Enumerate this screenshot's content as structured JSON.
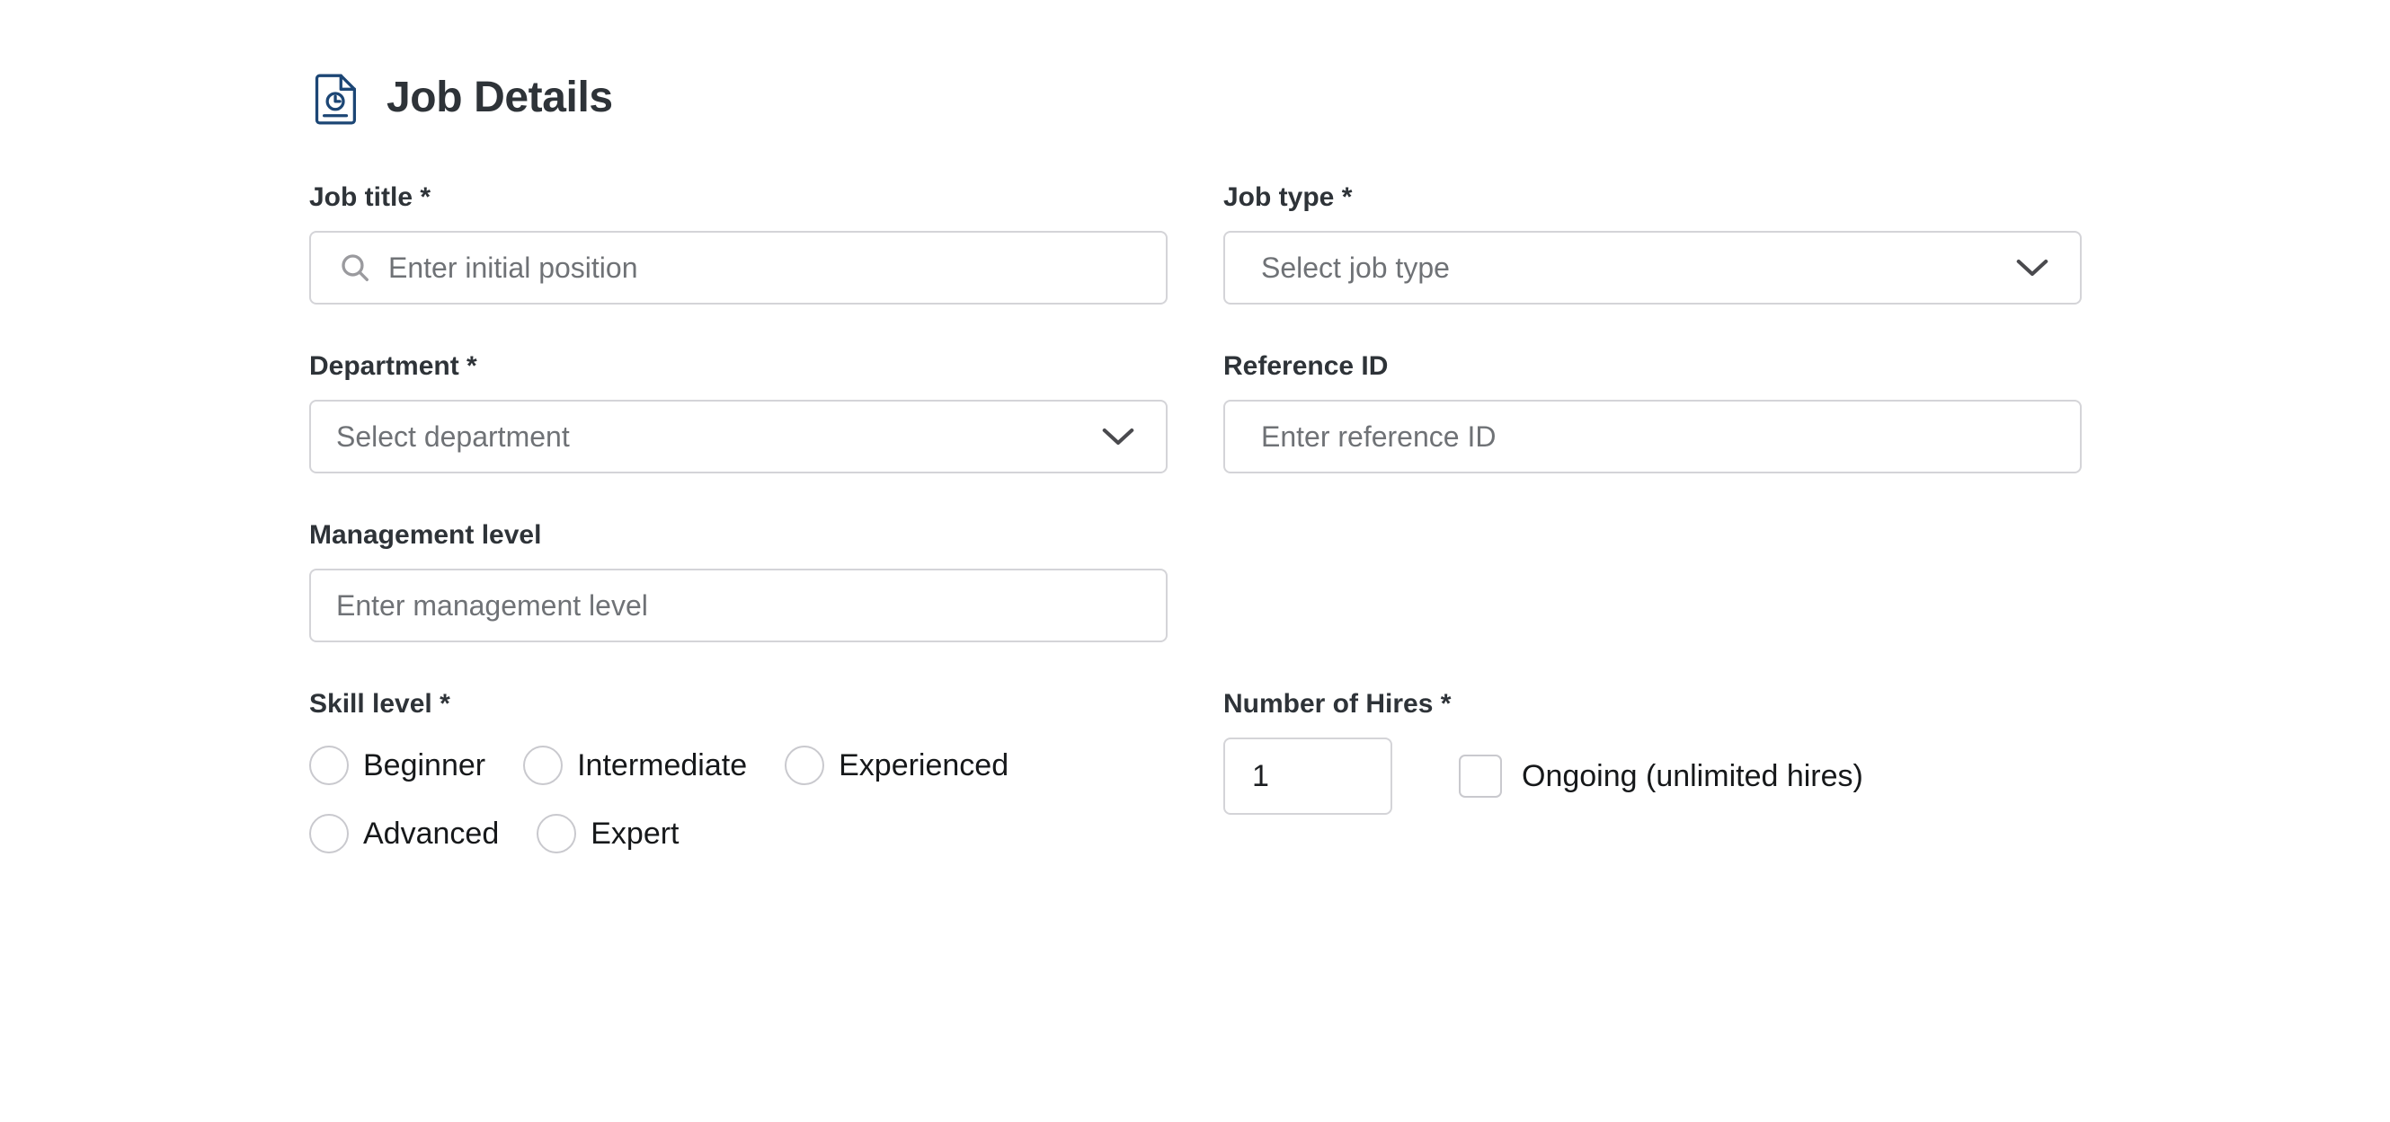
{
  "header": {
    "title": "Job Details",
    "icon": "document-clock-icon",
    "icon_color": "#1c4675"
  },
  "colors": {
    "border": "#d4d4d8",
    "control_border": "#c9c9ce",
    "placeholder": "#6f7276",
    "text": "#16181a",
    "label": "#2e3338",
    "background": "#ffffff"
  },
  "fields": {
    "job_title": {
      "label": "Job title *",
      "placeholder": "Enter initial position",
      "value": "",
      "icon": "search-icon"
    },
    "job_type": {
      "label": "Job type *",
      "placeholder": "Select job type",
      "value": "",
      "icon": "chevron-down-icon"
    },
    "department": {
      "label": "Department *",
      "placeholder": "Select department",
      "value": "",
      "icon": "chevron-down-icon"
    },
    "reference_id": {
      "label": "Reference ID",
      "placeholder": "Enter reference ID",
      "value": ""
    },
    "management_level": {
      "label": "Management level",
      "placeholder": "Enter management level",
      "value": ""
    },
    "skill_level": {
      "label": "Skill level *",
      "options": [
        "Beginner",
        "Intermediate",
        "Experienced",
        "Advanced",
        "Expert"
      ],
      "selected": ""
    },
    "number_of_hires": {
      "label": "Number of Hires *",
      "value": "1",
      "ongoing_label": "Ongoing (unlimited hires)",
      "ongoing_checked": false
    }
  }
}
